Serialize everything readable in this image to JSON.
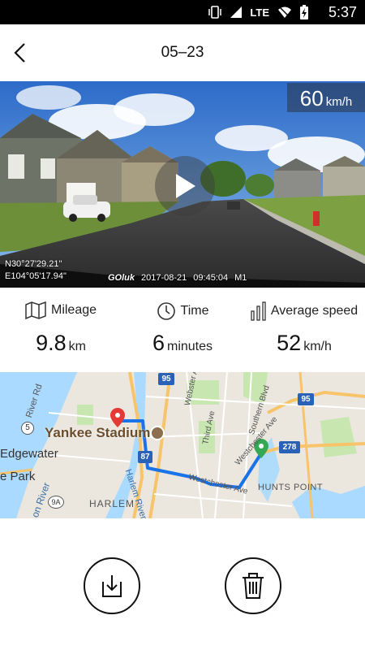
{
  "status_bar": {
    "network": "LTE",
    "time": "5:37"
  },
  "header": {
    "title": "05–23"
  },
  "video": {
    "speed_value": "60",
    "speed_unit": "km/h",
    "gps_lat": "N30°27'29.21\"",
    "gps_lon": "E104°05'17.94\"",
    "brand": "GOluk",
    "date": "2017-08-21",
    "time": "09:45:04",
    "mode": "M1"
  },
  "stats": {
    "mileage_label": "Mileage",
    "mileage_value": "9.8",
    "mileage_unit": "km",
    "time_label": "Time",
    "time_value": "6",
    "time_unit": "minutes",
    "speed_label": "Average speed",
    "speed_value": "52",
    "speed_unit": "km/h"
  },
  "map": {
    "labels": {
      "yankee": "Yankee Stadium",
      "edgewater": "Edgewater",
      "park": "e Park",
      "harlem": "HARLEM",
      "harlem_river": "Harlem River",
      "hunts_point": "HUNTS POINT",
      "webster": "Webster Ave",
      "third": "Third Ave",
      "southern": "Southern Blvd",
      "westchester_w": "Westchester Ave",
      "westchester_e": "Westchester Ave",
      "river": "River Rd",
      "on_river": "on River",
      "shield_95_top": "95",
      "shield_95_right": "95",
      "shield_87": "87",
      "shield_278": "278",
      "shield_5": "5",
      "shield_9a": "9A"
    },
    "colors": {
      "route": "#1a73e8",
      "start_pin": "#e53935",
      "end_pin": "#34a853",
      "water": "#aadaff",
      "park": "#c8e6b0"
    }
  },
  "icons": {
    "back": "back-arrow-icon",
    "play": "play-icon",
    "mileage": "map-icon",
    "time": "clock-icon",
    "speed": "bars-icon",
    "download": "download-icon",
    "delete": "trash-icon"
  }
}
